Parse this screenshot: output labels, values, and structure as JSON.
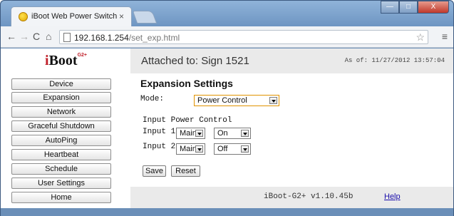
{
  "browser": {
    "tab_title": "iBoot Web Power Switch",
    "tab_close": "×",
    "url_host": "192.168.1.254",
    "url_path": "/set_exp.html",
    "back": "←",
    "forward": "→",
    "reload": "C",
    "home": "⌂",
    "star": "☆",
    "menu": "≡",
    "window_controls": {
      "minimize": "—",
      "maximize": "□",
      "close": "X"
    }
  },
  "logo": {
    "text": "Boot",
    "prefix": "i",
    "sup": "G2+"
  },
  "sidebar": {
    "items": [
      {
        "label": "Device"
      },
      {
        "label": "Expansion"
      },
      {
        "label": "Network"
      },
      {
        "label": "Graceful Shutdown"
      },
      {
        "label": "AutoPing"
      },
      {
        "label": "Heartbeat"
      },
      {
        "label": "Schedule"
      },
      {
        "label": "User Settings"
      },
      {
        "label": "Home"
      }
    ]
  },
  "header": {
    "attached": "Attached to: Sign 1521",
    "as_of": "As of: 11/27/2012 13:57:04"
  },
  "main": {
    "heading": "Expansion Settings",
    "mode_label": "Mode:",
    "mode_value": "Power Control",
    "section_label": "Input Power Control",
    "inputs": [
      {
        "label": "Input 1",
        "source": "Main",
        "state": "On"
      },
      {
        "label": "Input 2",
        "source": "Main",
        "state": "Off"
      }
    ],
    "save_label": "Save",
    "reset_label": "Reset"
  },
  "footer": {
    "version": "iBoot-G2+ v1.10.45b",
    "help": "Help"
  }
}
